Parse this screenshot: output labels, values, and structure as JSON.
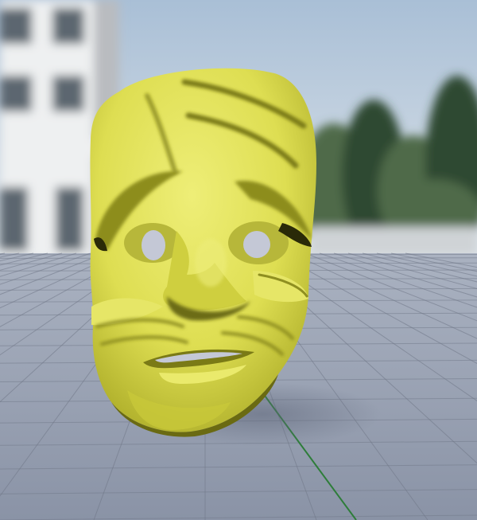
{
  "scene": {
    "subject": "mask-3d-model",
    "colors": {
      "sky_top": "#a9bfd6",
      "sky_bottom": "#dfe5ea",
      "building": "#eef0f1",
      "building_shadow": "#b9bcc0",
      "window": "#5b6670",
      "trees": "#4f6a4a",
      "trees_dark": "#2f4a33",
      "floor": "#8a93a6",
      "floor_far": "#aab2c1",
      "grid_line": "#6f7787",
      "axis_line": "#2e7d3a",
      "mask_base": "#dede52",
      "mask_light": "#eeee77",
      "mask_shadow": "#a6a623",
      "mask_deep": "#5e5e10",
      "mask_hole": "#c4c8d6"
    }
  }
}
